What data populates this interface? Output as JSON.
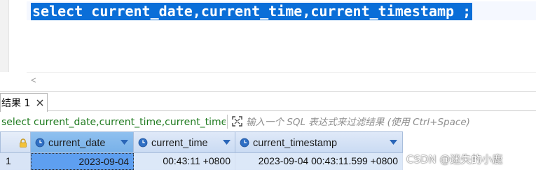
{
  "editor": {
    "sql": "select current_date,current_time,current_timestamp ;"
  },
  "scroll": {
    "left_arrow": "<"
  },
  "result_tab": {
    "label": "结果 1"
  },
  "filter": {
    "query_text": "select current_date,current_time,current_timestamp ;",
    "placeholder": "输入一个 SQL 表达式来过滤结果 (使用 Ctrl+Space)"
  },
  "grid": {
    "columns": [
      "current_date",
      "current_time",
      "current_timestamp"
    ],
    "rows": [
      {
        "num": "1",
        "current_date": "2023-09-04",
        "current_time": "00:43:11 +0800",
        "current_timestamp": "2023-09-04 00:43:11.599 +0800"
      }
    ]
  },
  "watermark": "CSDN @迷失的小鹿",
  "colors": {
    "selection": "#0a6ed8",
    "query_text": "#1e7a1e",
    "header_bg": "#cadbf3",
    "selected_cell": "#5e9ff0"
  },
  "icons": {
    "tab_close": "close-icon",
    "expand": "expand-icon",
    "header_corner": "lock-icon",
    "column": "clock-icon",
    "sort": "chevron-down-icon"
  }
}
